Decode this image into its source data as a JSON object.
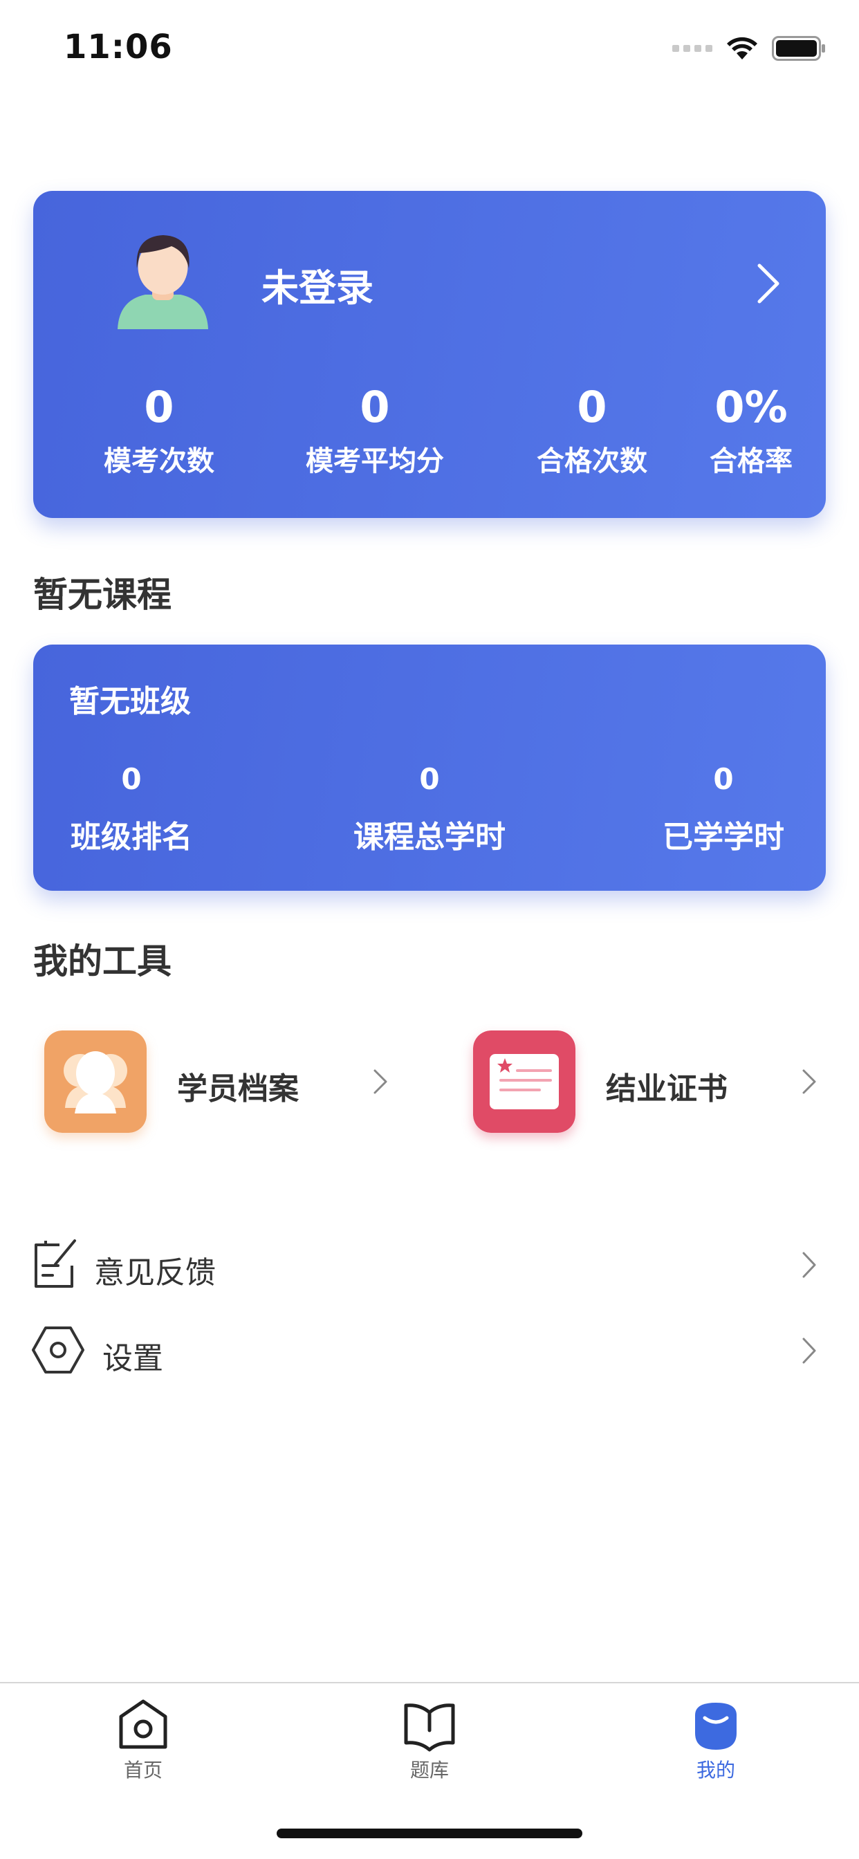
{
  "status_bar": {
    "time": "11:06"
  },
  "profile": {
    "login_status": "未登录",
    "stats": [
      {
        "value": "0",
        "label": "模考次数"
      },
      {
        "value": "0",
        "label": "模考平均分"
      },
      {
        "value": "0",
        "label": "合格次数"
      },
      {
        "value": "0%",
        "label": "合格率"
      }
    ]
  },
  "course_section": {
    "title": "暂无课程"
  },
  "class_card": {
    "title": "暂无班级",
    "stats": [
      {
        "value": "0",
        "label": "班级排名"
      },
      {
        "value": "0",
        "label": "课程总学时"
      },
      {
        "value": "0",
        "label": "已学学时"
      }
    ]
  },
  "tools_section": {
    "title": "我的工具",
    "items": [
      {
        "label": "学员档案",
        "icon": "student-profile-icon",
        "color": "#f0a366"
      },
      {
        "label": "结业证书",
        "icon": "certificate-icon",
        "color": "#e04b66"
      }
    ]
  },
  "list": [
    {
      "label": "意见反馈",
      "icon": "feedback-icon"
    },
    {
      "label": "设置",
      "icon": "settings-icon"
    }
  ],
  "tab_bar": {
    "tabs": [
      {
        "label": "首页",
        "icon": "home-icon",
        "active": false
      },
      {
        "label": "题库",
        "icon": "book-icon",
        "active": false
      },
      {
        "label": "我的",
        "icon": "profile-icon",
        "active": true
      }
    ]
  },
  "colors": {
    "accent": "#4a6ce0",
    "active_tab": "#3d6ae0"
  }
}
